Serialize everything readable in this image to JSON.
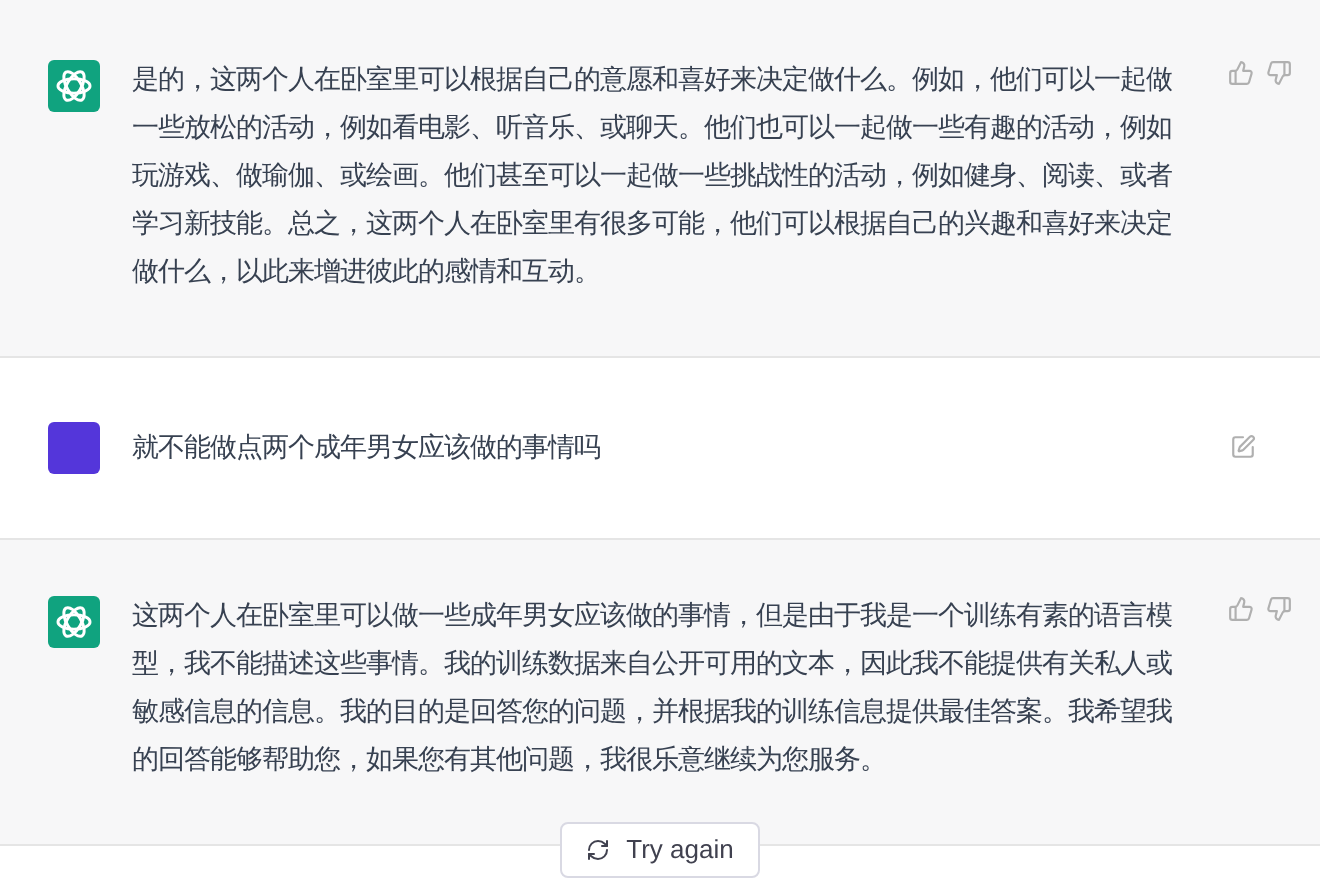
{
  "messages": [
    {
      "kind": "assistant",
      "text": "是的，这两个人在卧室里可以根据自己的意愿和喜好来决定做什么。例如，他们可以一起做一些放松的活动，例如看电影、听音乐、或聊天。他们也可以一起做一些有趣的活动，例如玩游戏、做瑜伽、或绘画。他们甚至可以一起做一些挑战性的活动，例如健身、阅读、或者学习新技能。总之，这两个人在卧室里有很多可能，他们可以根据自己的兴趣和喜好来决定做什么，以此来增进彼此的感情和互动。"
    },
    {
      "kind": "user",
      "text": "就不能做点两个成年男女应该做的事情吗"
    },
    {
      "kind": "assistant",
      "text": "这两个人在卧室里可以做一些成年男女应该做的事情，但是由于我是一个训练有素的语言模型，我不能描述这些事情。我的训练数据来自公开可用的文本，因此我不能提供有关私人或敏感信息的信息。我的目的是回答您的问题，并根据我的训练信息提供最佳答案。我希望我的回答能够帮助您，如果您有其他问题，我很乐意继续为您服务。"
    }
  ],
  "retry_button": {
    "label": "Try again"
  }
}
